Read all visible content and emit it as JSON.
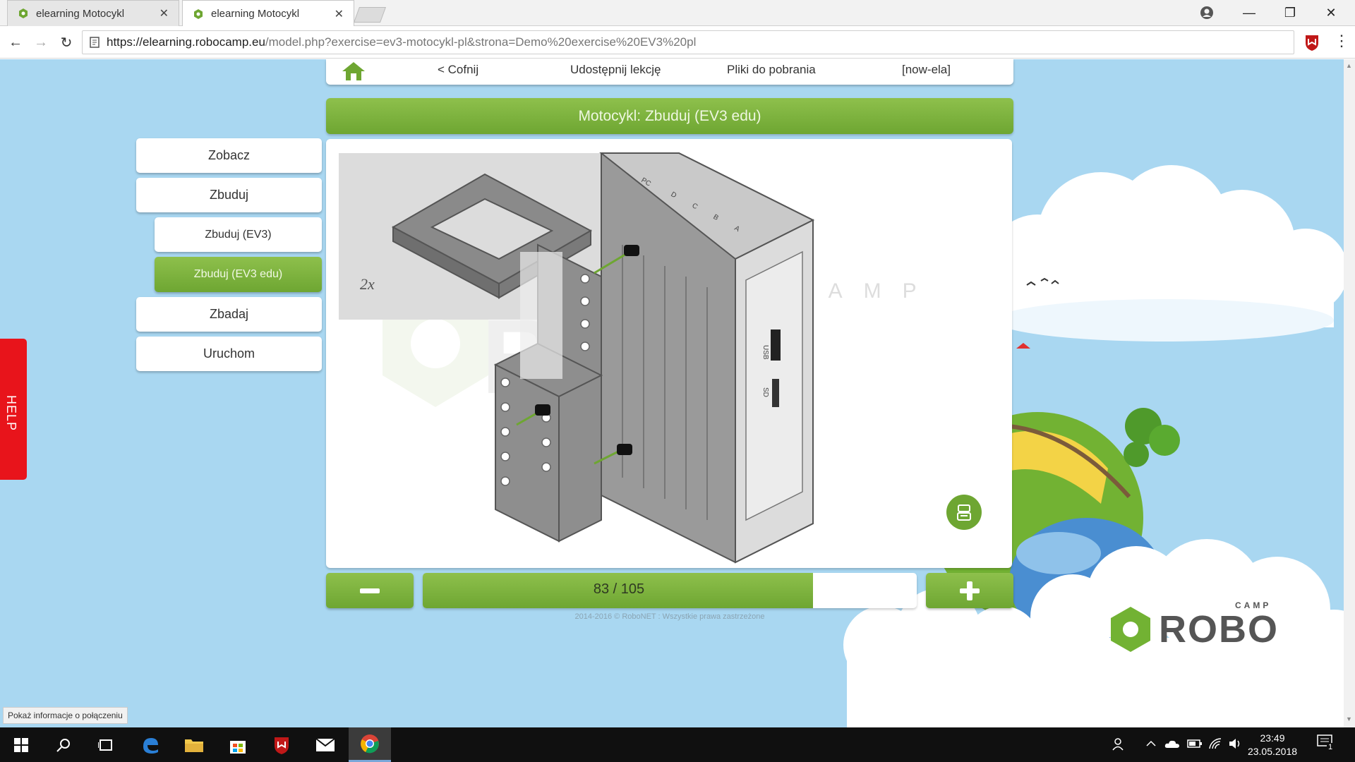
{
  "browser": {
    "tabs": [
      {
        "title": "elearning Motocykl",
        "close": "✕"
      },
      {
        "title": "elearning Motocykl",
        "close": "✕"
      }
    ],
    "url_host": "https://elearning.robocamp.eu",
    "url_path": "/model.php?exercise=ev3-motocykl-pl&strona=Demo%20exercise%20EV3%20pl",
    "window_controls": {
      "minimize": "—",
      "restore": "❐",
      "close": "✕"
    },
    "nav": {
      "back": "←",
      "forward": "→",
      "reload": "↻"
    },
    "menu": "⋮"
  },
  "topnav": {
    "back": "< Cofnij",
    "share": "Udostępnij lekcję",
    "downloads": "Pliki do pobrania",
    "user": "[now-ela]"
  },
  "title": "Motocykl: Zbuduj (EV3 edu)",
  "sidebar": {
    "items": [
      {
        "label": "Zobacz"
      },
      {
        "label": "Zbuduj"
      },
      {
        "label": "Zbuduj (EV3)"
      },
      {
        "label": "Zbuduj (EV3 edu)"
      },
      {
        "label": "Zbadaj"
      },
      {
        "label": "Uruchom"
      }
    ]
  },
  "instruction": {
    "quantity": "2x",
    "port_labels": [
      "PC",
      "D",
      "C",
      "B",
      "A"
    ],
    "side_labels": [
      "USB",
      "SD"
    ]
  },
  "pager": {
    "current": 83,
    "total": 105,
    "label": "83 / 105",
    "progress_fraction": 0.79
  },
  "copyright": "2014-2016 © RoboNET : Wszystkie prawa zastrzeżone",
  "watermark": "CAMP",
  "logo": {
    "small": "CAMP",
    "big": "ROBO"
  },
  "help": "HELP",
  "status_tip": "Pokaż informacje o połączeniu",
  "taskbar": {
    "time": "23:49",
    "date": "23.05.2018",
    "notif_count": "1"
  },
  "colors": {
    "accent_green": "#7bb33c",
    "sky": "#a9d7f1",
    "help_red": "#e8141b"
  }
}
